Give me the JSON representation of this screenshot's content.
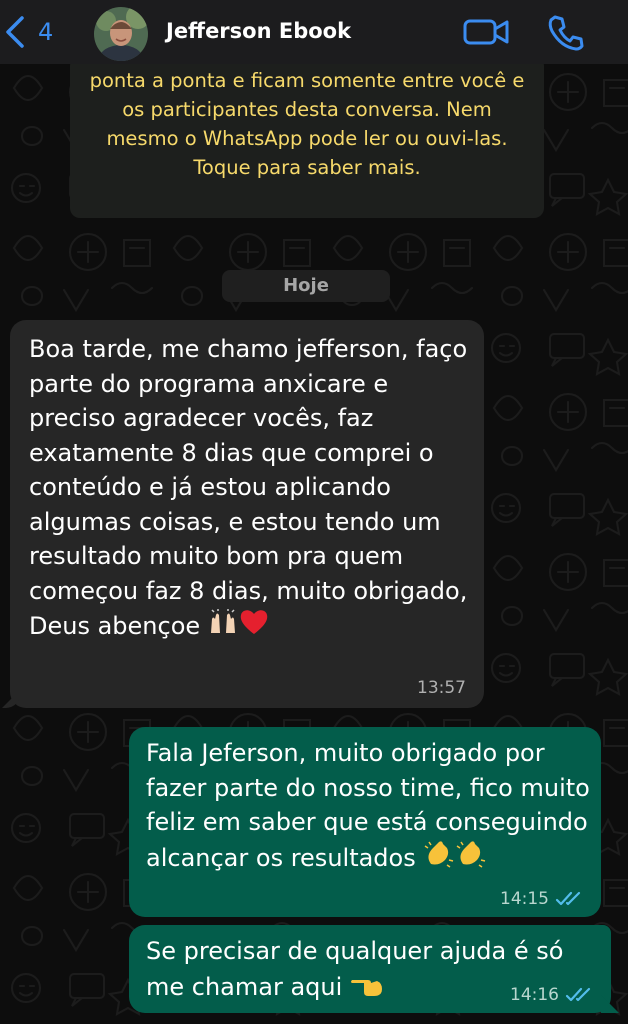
{
  "header": {
    "back_count": "4",
    "contact_name": "Jefferson Ebook",
    "back_icon": "chevron-left-icon",
    "video_icon": "video-camera-icon",
    "call_icon": "phone-icon",
    "accent_color": "#3b8cf0"
  },
  "encryption_notice": {
    "text": "ponta a ponta e ficam somente entre você e os participantes desta conversa. Nem mesmo o WhatsApp pode ler ou ouvi-las. Toque para saber mais."
  },
  "date_divider": "Hoje",
  "messages": [
    {
      "direction": "incoming",
      "text": "Boa tarde, me chamo jefferson, faço parte do programa anxicare e preciso agradecer vocês, faz exatamente 8 dias que comprei o conteúdo e já estou aplicando  algumas coisas, e estou tendo um resultado muito bom pra quem começou faz 8 dias, muito obrigado, Deus abençoe",
      "emojis": [
        "raising-hands-emoji",
        "red-heart-emoji"
      ],
      "time": "13:57"
    },
    {
      "direction": "outgoing",
      "text": "Fala Jeferson, muito obrigado por fazer parte do nosso time, fico muito feliz em saber que está conseguindo alcançar os resultados",
      "emojis": [
        "clapping-hands-emoji",
        "clapping-hands-emoji"
      ],
      "time": "14:15",
      "status": "read-double-check-icon"
    },
    {
      "direction": "outgoing",
      "text": "Se precisar de qualquer ajuda é só me chamar aqui",
      "emojis": [
        "pointing-hand-emoji"
      ],
      "time": "14:16",
      "status": "read-double-check-icon"
    }
  ],
  "colors": {
    "incoming_bubble": "#262626",
    "outgoing_bubble": "#035d4b",
    "notice_text": "#f6d96b",
    "read_ticks": "#53bdeb"
  }
}
